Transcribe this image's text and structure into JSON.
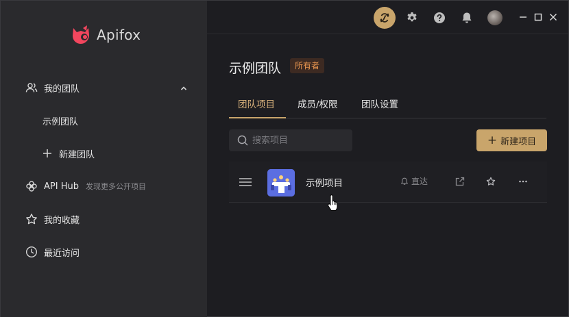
{
  "app": {
    "name": "Apifox"
  },
  "sidebar": {
    "items": [
      {
        "label": "我的团队",
        "icon": "users-icon"
      },
      {
        "label": "示例团队"
      },
      {
        "label": "新建团队",
        "icon": "plus-icon"
      },
      {
        "label": "API Hub",
        "hint": "发现更多公开项目",
        "icon": "hub-icon"
      },
      {
        "label": "我的收藏",
        "icon": "star-icon"
      },
      {
        "label": "最近访问",
        "icon": "clock-icon"
      }
    ]
  },
  "topbar": {
    "icons": [
      "sync-icon",
      "gear-icon",
      "help-icon",
      "bell-icon",
      "avatar",
      "minimize-icon",
      "maximize-icon",
      "close-icon"
    ]
  },
  "main": {
    "team_title": "示例团队",
    "owner_badge": "所有者",
    "tabs": [
      {
        "label": "团队项目",
        "active": true
      },
      {
        "label": "成员/权限",
        "active": false
      },
      {
        "label": "团队设置",
        "active": false
      }
    ],
    "search": {
      "placeholder": "搜索项目"
    },
    "new_project_label": "新建项目",
    "projects": [
      {
        "name": "示例项目",
        "direct_label": "直达"
      }
    ]
  },
  "colors": {
    "accent": "#c9a56b",
    "sidebar_bg": "#2a2a2d",
    "main_bg": "#1d1d21",
    "badge_text": "#e8954f",
    "logo": "#f2465e"
  }
}
